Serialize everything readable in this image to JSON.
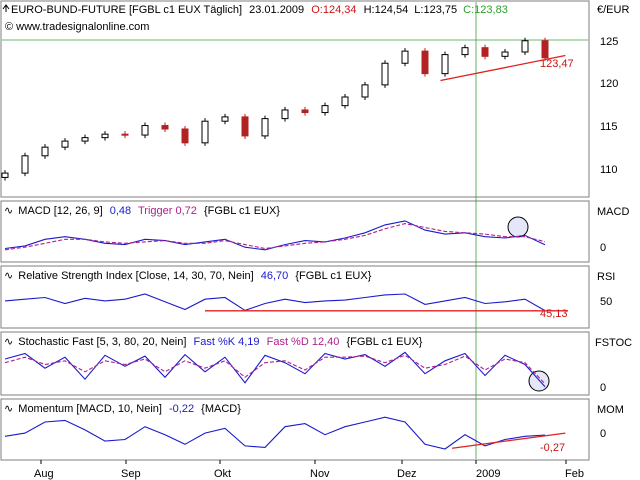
{
  "colors": {
    "frame": "#7f7f7f",
    "candle_up": "#000000",
    "candle_down": "#b22222",
    "trendline": "#e02020",
    "indicator": "#1a1acd",
    "trigger": "#b0208a",
    "crosshair": "#3aa03a",
    "label_blue": "#1a1acd",
    "label_red": "#c81414",
    "label_green": "#2ca02c"
  },
  "chart_data": [
    {
      "type": "candlestick",
      "panel": "price",
      "title": "EURO-BUND-FUTURE [FGBL c1 EUX  Täglich]",
      "date": "23.01.2009",
      "ohlc": {
        "O": "O:124,34",
        "H": "H:124,54",
        "L": "L:123,75",
        "C": "C:123,83"
      },
      "source": "© www.tradesignalonline.com",
      "ylabel": "€/EUR",
      "yticks": [
        110,
        115,
        120,
        125
      ],
      "ylim": [
        108.2,
        128.2
      ],
      "annotation": "123,47",
      "trendline": [
        {
          "x": "2008-12-18",
          "y": 121.2
        },
        {
          "x": "2009-01-30",
          "y": 124.1
        }
      ],
      "x": [
        "2008-07-21",
        "2008-07-28",
        "2008-08-04",
        "2008-08-11",
        "2008-08-18",
        "2008-08-25",
        "2008-09-01",
        "2008-09-08",
        "2008-09-15",
        "2008-09-22",
        "2008-09-29",
        "2008-10-06",
        "2008-10-13",
        "2008-10-20",
        "2008-10-27",
        "2008-11-03",
        "2008-11-10",
        "2008-11-17",
        "2008-11-24",
        "2008-12-01",
        "2008-12-08",
        "2008-12-15",
        "2008-12-22",
        "2008-12-29",
        "2009-01-05",
        "2009-01-12",
        "2009-01-19",
        "2009-01-23"
      ],
      "close": [
        110.5,
        112.5,
        113.5,
        114.2,
        114.6,
        115.0,
        114.9,
        116.0,
        115.6,
        114.0,
        116.5,
        117.0,
        114.8,
        116.8,
        117.8,
        117.5,
        118.3,
        119.3,
        120.7,
        123.2,
        124.6,
        122.0,
        124.2,
        125.0,
        124.0,
        124.5,
        125.8,
        123.83
      ]
    },
    {
      "type": "line",
      "panel": "macd",
      "title": "MACD [12, 26, 9]",
      "value_label": "0,48",
      "trigger_label": "Trigger 0,72",
      "instrument": "{FGBL c1 EUX}",
      "ylabel": "MACD",
      "yticks": [
        0
      ],
      "ylim": [
        -0.6,
        2.6
      ],
      "series": [
        {
          "name": "MACD",
          "values": [
            0.2,
            0.4,
            0.9,
            1.1,
            0.9,
            0.6,
            0.5,
            0.9,
            0.8,
            0.5,
            0.7,
            0.9,
            0.3,
            0.1,
            0.5,
            0.8,
            0.7,
            1.0,
            1.4,
            2.0,
            2.3,
            1.6,
            1.3,
            1.4,
            1.1,
            1.0,
            1.2,
            0.48
          ]
        },
        {
          "name": "Trigger",
          "values": [
            0.1,
            0.3,
            0.6,
            0.9,
            0.9,
            0.7,
            0.6,
            0.7,
            0.8,
            0.6,
            0.6,
            0.8,
            0.5,
            0.2,
            0.4,
            0.6,
            0.7,
            0.9,
            1.2,
            1.7,
            2.1,
            1.8,
            1.5,
            1.4,
            1.3,
            1.1,
            1.1,
            0.72
          ]
        }
      ]
    },
    {
      "type": "line",
      "panel": "rsi",
      "title": "Relative Strength Index [Close, 14, 30, 70, Nein]",
      "value_label": "46,70",
      "instrument": "{FGBL c1 EUX}",
      "ylabel": "RSI",
      "yticks": [
        50
      ],
      "ylim": [
        30,
        80
      ],
      "annotation": "45,13",
      "series": [
        {
          "name": "RSI",
          "values": [
            58,
            60,
            62,
            55,
            61,
            58,
            60,
            66,
            57,
            48,
            60,
            62,
            47,
            55,
            60,
            56,
            58,
            59,
            62,
            65,
            66,
            54,
            58,
            62,
            55,
            57,
            60,
            46.7
          ]
        }
      ]
    },
    {
      "type": "line",
      "panel": "stochastic",
      "title": "Stochastic Fast [5, 3, 80, 20, Nein]",
      "value_label": "Fast %K 4,19",
      "trigger_label": "Fast %D 12,40",
      "instrument": "{FGBL c1 EUX}",
      "ylabel": "FSTOC",
      "yticks": [
        0
      ],
      "ylim": [
        -10,
        110
      ],
      "series": [
        {
          "name": "Fast %K",
          "values": [
            80,
            95,
            55,
            85,
            25,
            90,
            60,
            88,
            30,
            92,
            45,
            85,
            15,
            90,
            70,
            40,
            95,
            80,
            92,
            60,
            98,
            40,
            75,
            95,
            35,
            90,
            65,
            4.19
          ]
        },
        {
          "name": "Fast %D",
          "values": [
            70,
            85,
            65,
            75,
            45,
            75,
            65,
            80,
            45,
            75,
            55,
            75,
            30,
            70,
            75,
            50,
            85,
            85,
            88,
            70,
            90,
            55,
            65,
            88,
            50,
            80,
            70,
            12.4
          ]
        }
      ]
    },
    {
      "type": "line",
      "panel": "momentum",
      "title": "Momentum [MACD, 10, Nein]",
      "value_label": "-0,22",
      "instrument": "{MACD}",
      "ylabel": "MOM",
      "yticks": [
        0
      ],
      "ylim": [
        -1.6,
        1.1
      ],
      "annotation": "-0,27",
      "trendline": [
        {
          "x": "2008-12-22",
          "y": -1.05
        },
        {
          "x": "2009-01-30",
          "y": -0.1
        }
      ],
      "series": [
        {
          "name": "Momentum",
          "values": [
            -0.3,
            -0.1,
            0.6,
            0.7,
            0.1,
            -0.6,
            -0.5,
            0.3,
            -0.2,
            -0.8,
            -0.1,
            0.2,
            -0.9,
            -1.0,
            0.3,
            0.5,
            -0.2,
            0.3,
            0.6,
            0.9,
            0.6,
            -0.8,
            -1.1,
            -0.2,
            -0.9,
            -0.5,
            -0.3,
            -0.22
          ]
        }
      ]
    }
  ],
  "x_axis": {
    "labels": [
      "Aug",
      "Sep",
      "Okt",
      "Nov",
      "Dez",
      "2009",
      "Feb"
    ]
  }
}
